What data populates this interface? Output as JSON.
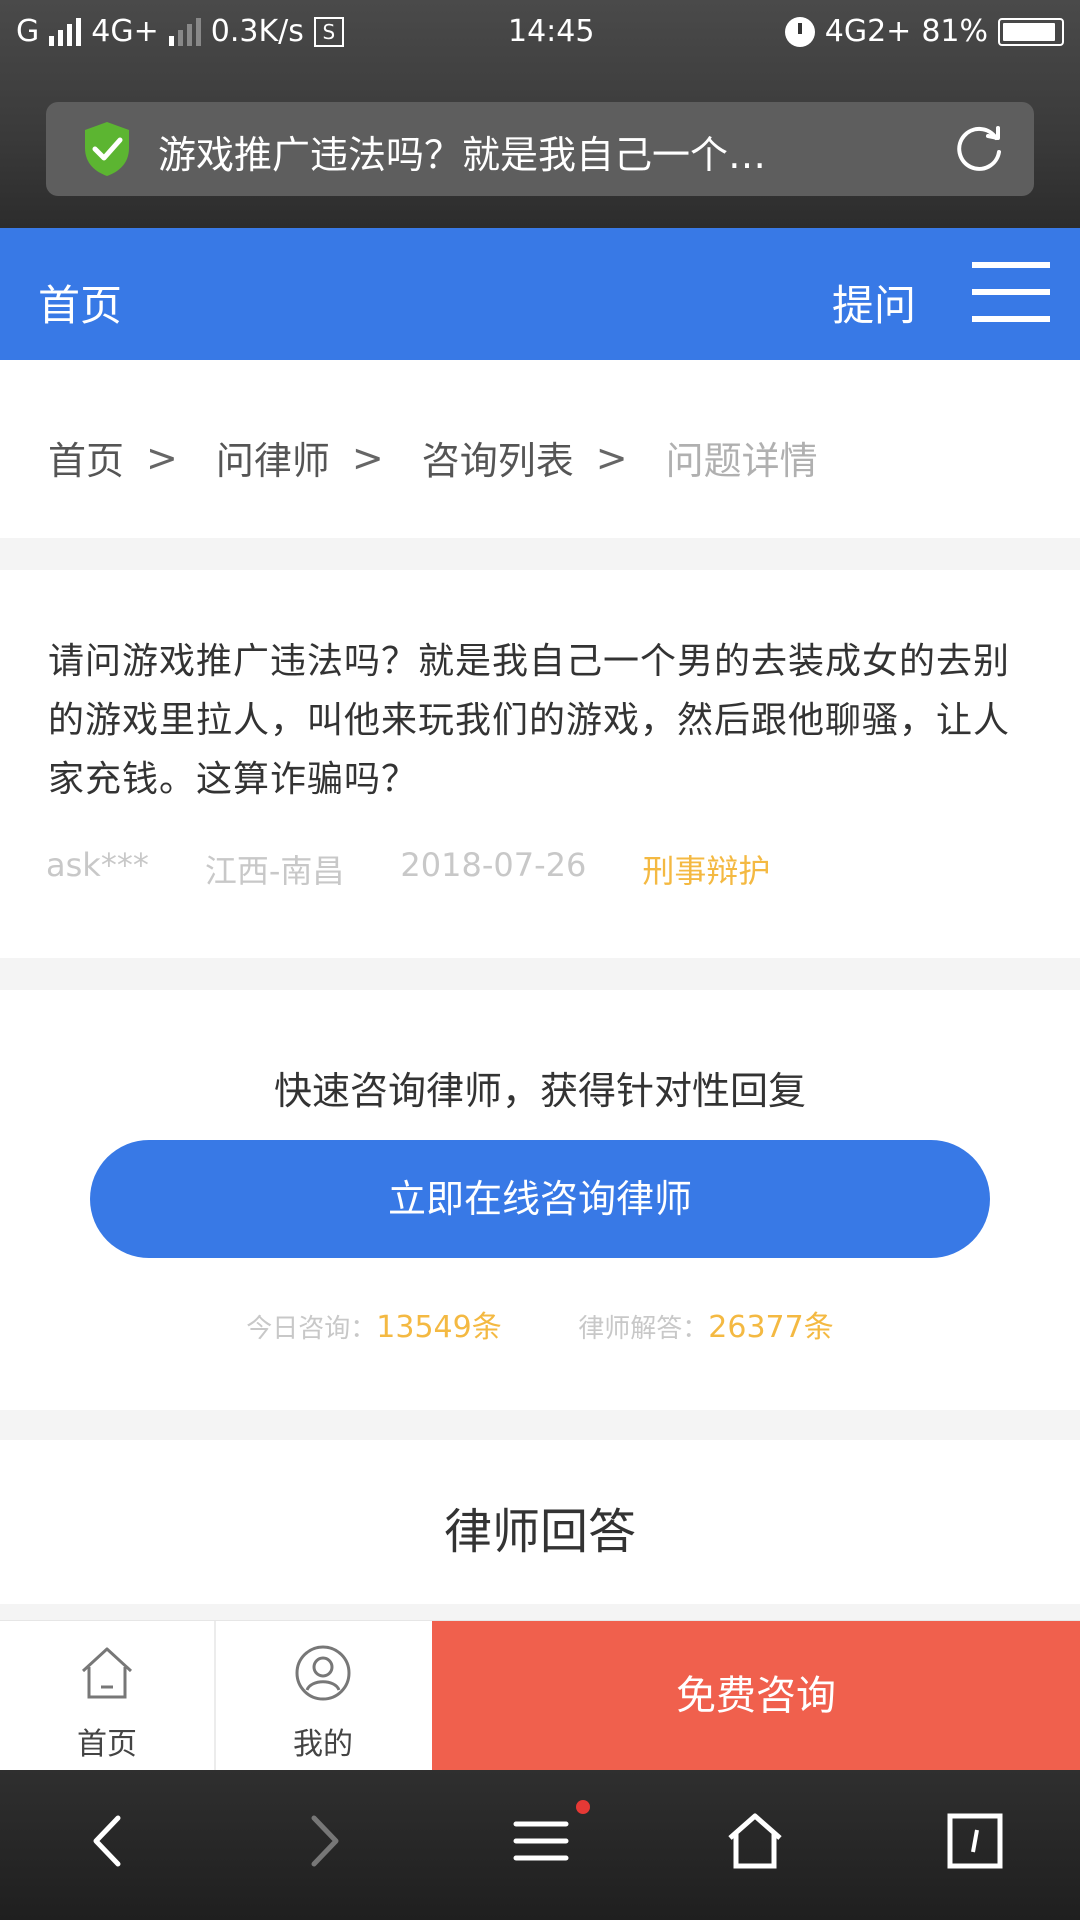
{
  "status_bar": {
    "carrier": "G",
    "network": "4G+",
    "speed": "0.3K/s",
    "s_icon": "S",
    "time": "14:45",
    "network2": "4G2+",
    "battery": "81%"
  },
  "browser": {
    "url_title": "游戏推广违法吗？就是我自己一个…"
  },
  "header": {
    "home": "首页",
    "ask": "提问"
  },
  "breadcrumb": [
    "首页",
    "问律师",
    "咨询列表",
    "问题详情"
  ],
  "breadcrumb_sep": ">",
  "question": {
    "text": "请问游戏推广违法吗？就是我自己一个男的去装成女的去别的游戏里拉人，叫他来玩我们的游戏，然后跟他聊骚，让人家充钱。这算诈骗吗？",
    "user": "ask***",
    "location": "江西-南昌",
    "date": "2018-07-26",
    "category": "刑事辩护"
  },
  "consult": {
    "title": "快速咨询律师，获得针对性回复",
    "button": "立即在线咨询律师",
    "today_label": "今日咨询：",
    "today_value": "13549",
    "today_unit": "条",
    "answers_label": "律师解答：",
    "answers_value": "26377",
    "answers_unit": "条"
  },
  "answers": {
    "title": "律师回答"
  },
  "tabs": {
    "home": "首页",
    "mine": "我的",
    "free": "免费咨询"
  },
  "colors": {
    "primary": "#3879e6",
    "accent_orange": "#f4b942",
    "free_button": "#f0604d"
  }
}
